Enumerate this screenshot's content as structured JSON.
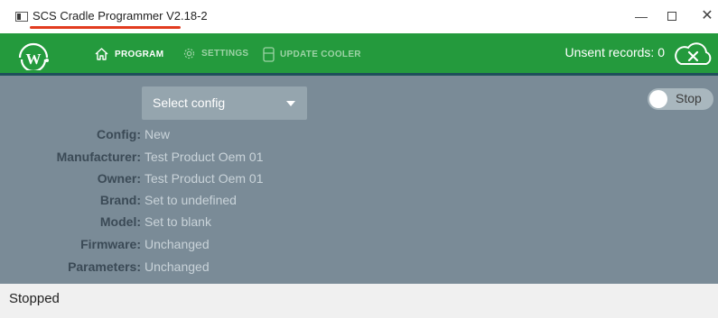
{
  "window": {
    "title": "SCS Cradle Programmer V2.18-2",
    "minimize_glyph": "—",
    "close_glyph": "✕"
  },
  "toolbar": {
    "logo_icon": "w-logo-icon",
    "nav": [
      {
        "label": "PROGRAM",
        "icon": "home-icon",
        "active": true
      },
      {
        "label": "SETTINGS",
        "icon": "gear-icon",
        "active": false
      },
      {
        "label": "UPDATE COOLER",
        "icon": "device-icon",
        "active": false
      }
    ],
    "unsent_records": "Unsent records: 0",
    "cloud_icon": "cloud-x-icon"
  },
  "main": {
    "select_config": {
      "label": "Select config"
    },
    "toggle": {
      "label": "Stop",
      "on": false
    },
    "fields": [
      {
        "key": "Config:",
        "value": "New"
      },
      {
        "key": "Manufacturer:",
        "value": "Test Product Oem 01"
      },
      {
        "key": "Owner:",
        "value": "Test Product Oem 01"
      },
      {
        "key": "Brand:",
        "value": "Set to undefined"
      },
      {
        "key": "Model:",
        "value": "Set to blank"
      },
      {
        "key": "Firmware:",
        "value": "Unchanged"
      },
      {
        "key": "Parameters:",
        "value": "Unchanged"
      }
    ]
  },
  "status": {
    "text": "Stopped"
  },
  "colors": {
    "toolbar_green": "#249a3d",
    "main_gray": "#7a8b97",
    "title_underline": "#e23b1f",
    "field_key": "#3b4a56",
    "field_value": "#c9d3d9"
  }
}
